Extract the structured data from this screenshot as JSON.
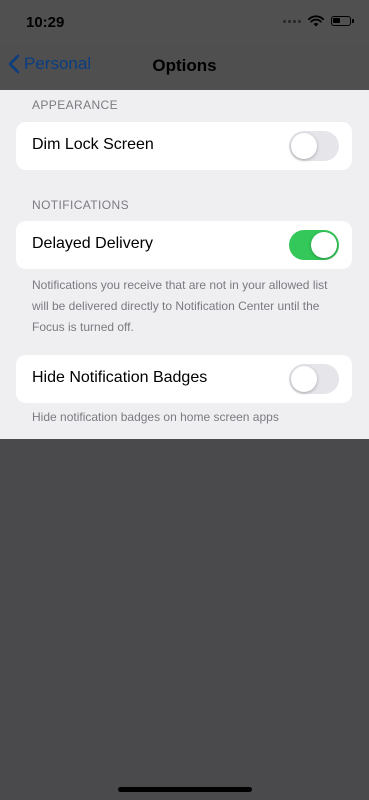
{
  "status_bar": {
    "time": "10:29"
  },
  "nav": {
    "back_label": "Personal",
    "title": "Options"
  },
  "sections": {
    "appearance": {
      "header": "APPEARANCE",
      "dim_lock_screen": {
        "label": "Dim Lock Screen",
        "enabled": false
      }
    },
    "notifications": {
      "header": "NOTIFICATIONS",
      "delayed_delivery": {
        "label": "Delayed Delivery",
        "enabled": true,
        "footer": "Notifications you receive that are not in your allowed list will be delivered directly to Notification Center until the Focus is turned off."
      },
      "hide_badges": {
        "label": "Hide Notification Badges",
        "enabled": false,
        "footer": "Hide notification badges on home screen apps"
      }
    }
  },
  "colors": {
    "accent": "#0a3d80",
    "toggle_on": "#34c759",
    "toggle_off": "#e5e5ea",
    "overlay": "#4a4a4c"
  }
}
